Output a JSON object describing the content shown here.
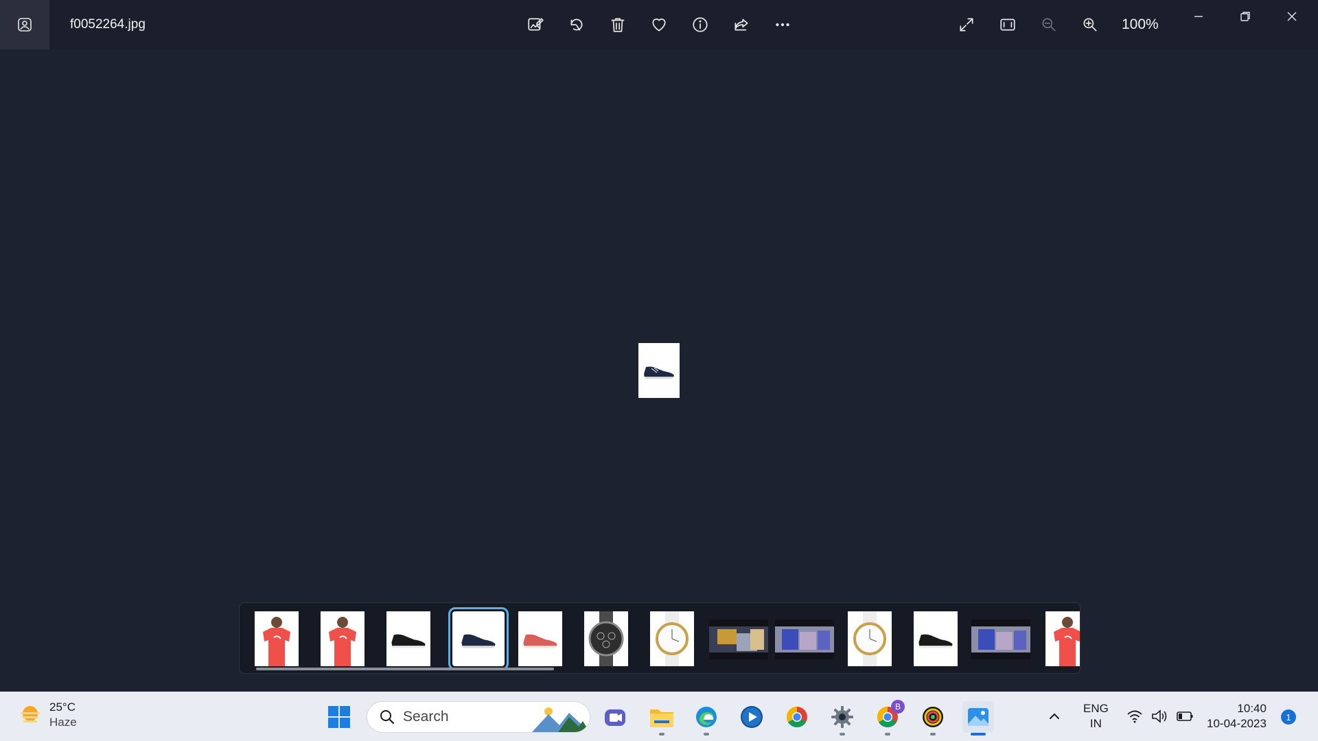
{
  "titlebar": {
    "filename": "f0052264.jpg",
    "zoom": "100%",
    "icons": [
      "edit-image-icon",
      "rotate-icon",
      "delete-icon",
      "favorite-icon",
      "info-icon",
      "share-icon",
      "more-icon"
    ],
    "view_icons": [
      "full-screen-icon",
      "fit-window-icon",
      "zoom-out-icon",
      "zoom-in-icon"
    ]
  },
  "filmstrip": {
    "thumbnails": [
      {
        "subject": "red-tshirt"
      },
      {
        "subject": "red-tshirt"
      },
      {
        "subject": "black-sneaker"
      },
      {
        "subject": "navy-sneaker",
        "selected": true
      },
      {
        "subject": "red-sneaker"
      },
      {
        "subject": "chronograph-watch"
      },
      {
        "subject": "gold-white-watch"
      },
      {
        "subject": "blurry-photo"
      },
      {
        "subject": "blurry-photo"
      },
      {
        "subject": "gold-white-watch"
      },
      {
        "subject": "black-sneaker"
      },
      {
        "subject": "blurry-photo"
      },
      {
        "subject": "red-tshirt"
      }
    ]
  },
  "taskbar": {
    "weather": {
      "temp": "25°C",
      "condition": "Haze"
    },
    "search_label": "Search",
    "apps": [
      "start",
      "search",
      "teams-meet",
      "file-explorer",
      "edge",
      "media-player",
      "chrome",
      "settings",
      "chrome-profile",
      "camera-app",
      "photos"
    ],
    "profile_badge": "B",
    "language": {
      "line1": "ENG",
      "line2": "IN"
    },
    "clock": {
      "time": "10:40",
      "date": "10-04-2023"
    },
    "notifications": "1"
  },
  "colors": {
    "background": "#1d2230",
    "accent": "#5ab0e8",
    "taskbar": "#e9edf3"
  }
}
